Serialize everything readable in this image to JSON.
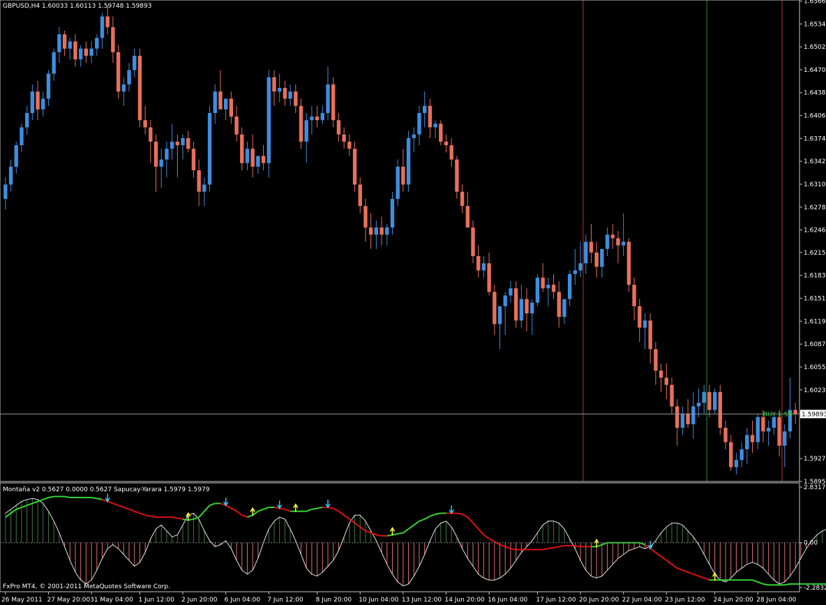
{
  "colors": {
    "background": "#000000",
    "bull": "#3d8ee0",
    "bear": "#e8705a",
    "grid_red": "#c0302c",
    "grid_green": "#2e8b2e",
    "axis": "#c8c8c8",
    "indicator_green": "#33d633",
    "indicator_red": "#e01010",
    "osc_line": "#e8e8e8",
    "hist_pos": "#3f7a3f",
    "hist_neg": "#e07070",
    "arrow_up": "#ffff33",
    "arrow_down": "#33ccff"
  },
  "header": {
    "symbol_line": "GBPUSD,H4  1.60033 1.60113 1.59748 1.59893",
    "indicator_line": "Montaña v2 0.5627 0.0000 0.5627 Sapucay-Yarara 1.5979 1.5979",
    "copyright": "FxPro MT4, © 2001-2011 MetaQuotes Software Corp."
  },
  "price_axis": {
    "ticks": [
      "1.65665",
      "1.65345",
      "1.65025",
      "1.64705",
      "1.64385",
      "1.64065",
      "1.63745",
      "1.63425",
      "1.63105",
      "1.62785",
      "1.62465",
      "1.62150",
      "1.61830",
      "1.61510",
      "1.61190",
      "1.60870",
      "1.60550",
      "1.60230",
      "1.59910",
      "1.59270",
      "1.58950"
    ],
    "current_price": "1.59893",
    "bid_label": "BUY 1.59"
  },
  "indicator_axis": {
    "ticks": [
      "2.8317",
      "0.00",
      "-2.2832"
    ]
  },
  "time_axis": {
    "labels": [
      "26 May 2011",
      "27 May 20:00",
      "31 May 04:00",
      "1 Jun 12:00",
      "2 Jun 20:00",
      "6 Jun 04:00",
      "7 Jun 12:00",
      "8 Jun 20:00",
      "10 Jun 04:00",
      "13 Jun 12:00",
      "14 Jun 20:00",
      "16 Jun 04:00",
      "17 Jun 12:00",
      "20 Jun 20:00",
      "22 Jun 04:00",
      "23 Jun 12:00",
      "24 Jun 20:00",
      "28 Jun 04:00"
    ]
  },
  "chart_data": {
    "type": "candlestick",
    "symbol": "GBPUSD",
    "timeframe": "H4",
    "ylim": [
      1.5895,
      1.6566
    ],
    "ohlc": [
      [
        1.629,
        1.632,
        1.6275,
        1.631
      ],
      [
        1.631,
        1.6345,
        1.63,
        1.6335
      ],
      [
        1.6335,
        1.637,
        1.6325,
        1.6365
      ],
      [
        1.6365,
        1.6395,
        1.6355,
        1.639
      ],
      [
        1.639,
        1.642,
        1.638,
        1.641
      ],
      [
        1.641,
        1.645,
        1.64,
        1.644
      ],
      [
        1.644,
        1.6455,
        1.64,
        1.6415
      ],
      [
        1.6415,
        1.644,
        1.6405,
        1.643
      ],
      [
        1.643,
        1.647,
        1.642,
        1.6465
      ],
      [
        1.6465,
        1.65,
        1.6455,
        1.6495
      ],
      [
        1.6495,
        1.653,
        1.648,
        1.652
      ],
      [
        1.652,
        1.6525,
        1.649,
        1.65
      ],
      [
        1.65,
        1.6515,
        1.6485,
        1.651
      ],
      [
        1.651,
        1.652,
        1.6475,
        1.6485
      ],
      [
        1.6485,
        1.6505,
        1.6475,
        1.65
      ],
      [
        1.65,
        1.651,
        1.648,
        1.649
      ],
      [
        1.649,
        1.651,
        1.648,
        1.65
      ],
      [
        1.65,
        1.652,
        1.649,
        1.6515
      ],
      [
        1.6515,
        1.655,
        1.65,
        1.6545
      ],
      [
        1.6545,
        1.656,
        1.652,
        1.653
      ],
      [
        1.653,
        1.6545,
        1.648,
        1.6495
      ],
      [
        1.6495,
        1.6505,
        1.643,
        1.644
      ],
      [
        1.644,
        1.646,
        1.642,
        1.645
      ],
      [
        1.645,
        1.648,
        1.644,
        1.647
      ],
      [
        1.647,
        1.65,
        1.646,
        1.649
      ],
      [
        1.649,
        1.65,
        1.639,
        1.64
      ],
      [
        1.64,
        1.642,
        1.638,
        1.639
      ],
      [
        1.639,
        1.64,
        1.634,
        1.637
      ],
      [
        1.637,
        1.638,
        1.63,
        1.6335
      ],
      [
        1.6335,
        1.636,
        1.6305,
        1.6345
      ],
      [
        1.6345,
        1.637,
        1.632,
        1.636
      ],
      [
        1.636,
        1.6395,
        1.6345,
        1.637
      ],
      [
        1.637,
        1.638,
        1.632,
        1.6365
      ],
      [
        1.6365,
        1.638,
        1.6345,
        1.6375
      ],
      [
        1.6375,
        1.6385,
        1.6355,
        1.636
      ],
      [
        1.636,
        1.637,
        1.632,
        1.633
      ],
      [
        1.633,
        1.6345,
        1.628,
        1.63
      ],
      [
        1.63,
        1.632,
        1.628,
        1.631
      ],
      [
        1.631,
        1.642,
        1.63,
        1.641
      ],
      [
        1.641,
        1.645,
        1.6395,
        1.644
      ],
      [
        1.644,
        1.647,
        1.642,
        1.6415
      ],
      [
        1.6415,
        1.643,
        1.64,
        1.643
      ],
      [
        1.643,
        1.644,
        1.6395,
        1.6405
      ],
      [
        1.6405,
        1.642,
        1.637,
        1.638
      ],
      [
        1.638,
        1.639,
        1.633,
        1.634
      ],
      [
        1.634,
        1.637,
        1.633,
        1.636
      ],
      [
        1.636,
        1.638,
        1.632,
        1.6335
      ],
      [
        1.6335,
        1.635,
        1.6325,
        1.635
      ],
      [
        1.635,
        1.6365,
        1.633,
        1.634
      ],
      [
        1.634,
        1.647,
        1.632,
        1.646
      ],
      [
        1.646,
        1.647,
        1.642,
        1.644
      ],
      [
        1.644,
        1.6465,
        1.6425,
        1.6445
      ],
      [
        1.6445,
        1.6455,
        1.642,
        1.643
      ],
      [
        1.643,
        1.645,
        1.642,
        1.644
      ],
      [
        1.644,
        1.645,
        1.641,
        1.642
      ],
      [
        1.642,
        1.643,
        1.636,
        1.637
      ],
      [
        1.637,
        1.641,
        1.634,
        1.64
      ],
      [
        1.64,
        1.642,
        1.638,
        1.6405
      ],
      [
        1.6405,
        1.642,
        1.639,
        1.64
      ],
      [
        1.64,
        1.642,
        1.6395,
        1.641
      ],
      [
        1.641,
        1.6475,
        1.64,
        1.645
      ],
      [
        1.645,
        1.646,
        1.639,
        1.64
      ],
      [
        1.64,
        1.641,
        1.637,
        1.638
      ],
      [
        1.638,
        1.639,
        1.636,
        1.637
      ],
      [
        1.637,
        1.638,
        1.635,
        1.636
      ],
      [
        1.636,
        1.637,
        1.63,
        1.631
      ],
      [
        1.631,
        1.632,
        1.627,
        1.628
      ],
      [
        1.628,
        1.629,
        1.623,
        1.625
      ],
      [
        1.625,
        1.627,
        1.622,
        1.624
      ],
      [
        1.624,
        1.626,
        1.622,
        1.625
      ],
      [
        1.625,
        1.6265,
        1.6225,
        1.624
      ],
      [
        1.624,
        1.6255,
        1.6225,
        1.625
      ],
      [
        1.625,
        1.63,
        1.624,
        1.629
      ],
      [
        1.629,
        1.6345,
        1.628,
        1.6335
      ],
      [
        1.6335,
        1.636,
        1.63,
        1.631
      ],
      [
        1.631,
        1.6385,
        1.63,
        1.6375
      ],
      [
        1.6375,
        1.639,
        1.6355,
        1.638
      ],
      [
        1.638,
        1.642,
        1.6365,
        1.641
      ],
      [
        1.641,
        1.644,
        1.639,
        1.642
      ],
      [
        1.642,
        1.643,
        1.6375,
        1.639
      ],
      [
        1.639,
        1.64,
        1.6375,
        1.6395
      ],
      [
        1.6395,
        1.64,
        1.6365,
        1.637
      ],
      [
        1.637,
        1.638,
        1.6355,
        1.6365
      ],
      [
        1.6365,
        1.6375,
        1.6335,
        1.6345
      ],
      [
        1.6345,
        1.635,
        1.629,
        1.63
      ],
      [
        1.63,
        1.631,
        1.627,
        1.628
      ],
      [
        1.628,
        1.63,
        1.625,
        1.625
      ],
      [
        1.625,
        1.626,
        1.62,
        1.621
      ],
      [
        1.621,
        1.6225,
        1.618,
        1.619
      ],
      [
        1.619,
        1.621,
        1.618,
        1.62
      ],
      [
        1.62,
        1.6215,
        1.6155,
        1.616
      ],
      [
        1.616,
        1.617,
        1.61,
        1.6115
      ],
      [
        1.6115,
        1.614,
        1.608,
        1.614
      ],
      [
        1.614,
        1.616,
        1.61,
        1.6155
      ],
      [
        1.6155,
        1.6175,
        1.6145,
        1.6165
      ],
      [
        1.6165,
        1.6175,
        1.611,
        1.612
      ],
      [
        1.612,
        1.617,
        1.611,
        1.615
      ],
      [
        1.615,
        1.6165,
        1.6105,
        1.613
      ],
      [
        1.613,
        1.615,
        1.61,
        1.6145
      ],
      [
        1.6145,
        1.6185,
        1.614,
        1.618
      ],
      [
        1.618,
        1.62,
        1.616,
        1.6165
      ],
      [
        1.6165,
        1.618,
        1.614,
        1.617
      ],
      [
        1.617,
        1.6185,
        1.615,
        1.616
      ],
      [
        1.616,
        1.6175,
        1.611,
        1.6125
      ],
      [
        1.6125,
        1.615,
        1.6115,
        1.615
      ],
      [
        1.615,
        1.619,
        1.614,
        1.6185
      ],
      [
        1.6185,
        1.622,
        1.617,
        1.619
      ],
      [
        1.619,
        1.623,
        1.618,
        1.62
      ],
      [
        1.62,
        1.624,
        1.6185,
        1.623
      ],
      [
        1.623,
        1.6255,
        1.62,
        1.6215
      ],
      [
        1.6215,
        1.623,
        1.618,
        1.6195
      ],
      [
        1.6195,
        1.622,
        1.618,
        1.622
      ],
      [
        1.622,
        1.625,
        1.621,
        1.624
      ],
      [
        1.624,
        1.6255,
        1.622,
        1.6235
      ],
      [
        1.6235,
        1.6245,
        1.62,
        1.6225
      ],
      [
        1.6225,
        1.627,
        1.621,
        1.623
      ],
      [
        1.623,
        1.6235,
        1.616,
        1.617
      ],
      [
        1.617,
        1.618,
        1.612,
        1.614
      ],
      [
        1.614,
        1.615,
        1.609,
        1.611
      ],
      [
        1.611,
        1.613,
        1.608,
        1.612
      ],
      [
        1.612,
        1.613,
        1.606,
        1.608
      ],
      [
        1.608,
        1.609,
        1.603,
        1.605
      ],
      [
        1.605,
        1.606,
        1.602,
        1.604
      ],
      [
        1.604,
        1.606,
        1.601,
        1.603
      ],
      [
        1.603,
        1.604,
        1.599,
        1.6
      ],
      [
        1.6,
        1.601,
        1.5945,
        1.597
      ],
      [
        1.597,
        1.6,
        1.596,
        1.599
      ],
      [
        1.599,
        1.601,
        1.597,
        1.5975
      ],
      [
        1.5975,
        1.602,
        1.5955,
        1.6
      ],
      [
        1.6,
        1.6025,
        1.5985,
        1.6005
      ],
      [
        1.6005,
        1.603,
        1.599,
        1.602
      ],
      [
        1.602,
        1.603,
        1.5985,
        1.5995
      ],
      [
        1.5995,
        1.6025,
        1.599,
        1.602
      ],
      [
        1.602,
        1.603,
        1.596,
        1.597
      ],
      [
        1.597,
        1.598,
        1.594,
        1.595
      ],
      [
        1.595,
        1.596,
        1.591,
        1.5915
      ],
      [
        1.5915,
        1.5935,
        1.5905,
        1.5925
      ],
      [
        1.5925,
        1.595,
        1.5915,
        1.594
      ],
      [
        1.594,
        1.597,
        1.592,
        1.596
      ],
      [
        1.596,
        1.598,
        1.5935,
        1.595
      ],
      [
        1.595,
        1.599,
        1.594,
        1.5985
      ],
      [
        1.5985,
        1.5995,
        1.595,
        1.5965
      ],
      [
        1.5965,
        1.598,
        1.5945,
        1.597
      ],
      [
        1.597,
        1.599,
        1.596,
        1.5985
      ],
      [
        1.5985,
        1.5995,
        1.593,
        1.5945
      ],
      [
        1.5945,
        1.5975,
        1.5915,
        1.5965
      ],
      [
        1.5965,
        1.604,
        1.5955,
        1.5995
      ],
      [
        1.5995,
        1.6005,
        1.5975,
        1.5989
      ]
    ],
    "vlines": [
      {
        "bar": 107.5,
        "color": "red"
      },
      {
        "bar": 130.5,
        "color": "green"
      },
      {
        "bar": 144.5,
        "color": "red"
      },
      {
        "bar": 177.5,
        "color": "green"
      }
    ],
    "indicator": {
      "name": "Montaña v2 / Sapucay-Yarara",
      "ylim": [
        -2.2832,
        2.8317
      ],
      "oscillator": [
        1.5,
        1.7,
        1.9,
        2.1,
        2.2,
        2.25,
        2.2,
        2.0,
        1.6,
        1.1,
        0.5,
        -0.2,
        -0.9,
        -1.5,
        -1.9,
        -2.1,
        -1.9,
        -1.4,
        -0.8,
        -0.3,
        -0.1,
        -0.3,
        -0.6,
        -0.9,
        -1.2,
        -1.0,
        -0.5,
        0.2,
        0.7,
        0.9,
        0.6,
        0.3,
        0.4,
        0.9,
        1.4,
        1.5,
        1.2,
        0.6,
        0.1,
        -0.2,
        -0.1,
        0.1,
        -0.3,
        -0.9,
        -1.4,
        -1.6,
        -1.4,
        -0.8,
        0.0,
        0.7,
        1.1,
        1.3,
        1.2,
        0.7,
        0.1,
        -0.6,
        -1.3,
        -1.6,
        -1.7,
        -1.5,
        -1.2,
        -0.9,
        -0.4,
        0.3,
        1.0,
        1.4,
        1.4,
        1.1,
        0.6,
        0.1,
        -0.5,
        -1.1,
        -1.6,
        -2.0,
        -2.2,
        -2.1,
        -1.7,
        -1.2,
        -0.6,
        0.1,
        0.7,
        1.0,
        1.1,
        0.8,
        0.3,
        -0.3,
        -0.8,
        -1.2,
        -1.6,
        -1.8,
        -1.9,
        -1.9,
        -1.8,
        -1.6,
        -1.3,
        -0.9,
        -0.5,
        -0.2,
        0.1,
        0.5,
        0.9,
        1.1,
        1.1,
        1.0,
        0.7,
        0.2,
        -0.3,
        -0.9,
        -1.4,
        -1.7,
        -1.8,
        -1.7,
        -1.4,
        -1.1,
        -0.8,
        -0.6,
        -0.4,
        -0.3,
        -0.2,
        -0.3,
        -0.2,
        0.1,
        0.5,
        0.8,
        1.0,
        1.0,
        0.9,
        0.6,
        0.3,
        -0.1,
        -0.6,
        -1.1,
        -1.6,
        -1.9,
        -2.0,
        -1.8,
        -1.5,
        -1.3,
        -1.1,
        -1.0,
        -1.1,
        -1.3,
        -1.6,
        -1.9,
        -2.1,
        -2.0,
        -1.7,
        -1.3,
        -0.8,
        -0.3,
        0.1,
        0.4,
        0.6,
        0.7,
        0.7
      ],
      "signal": [
        1.3,
        1.5,
        1.7,
        1.8,
        1.9,
        2.0,
        2.1,
        2.2,
        2.3,
        2.35,
        2.35,
        2.35,
        2.3,
        2.3,
        2.3,
        2.3,
        2.3,
        2.25,
        2.2,
        2.1,
        2.0,
        1.9,
        1.8,
        1.7,
        1.6,
        1.5,
        1.4,
        1.35,
        1.3,
        1.3,
        1.3,
        1.3,
        1.25,
        1.2,
        1.15,
        1.2,
        1.3,
        1.6,
        1.9,
        2.0,
        2.0,
        1.9,
        1.75,
        1.6,
        1.4,
        1.3,
        1.4,
        1.6,
        1.7,
        1.8,
        1.8,
        1.75,
        1.7,
        1.6,
        1.6,
        1.6,
        1.6,
        1.7,
        1.75,
        1.8,
        1.8,
        1.75,
        1.6,
        1.4,
        1.2,
        1.0,
        0.8,
        0.6,
        0.5,
        0.4,
        0.35,
        0.35,
        0.4,
        0.45,
        0.5,
        0.7,
        0.9,
        1.1,
        1.2,
        1.35,
        1.45,
        1.5,
        1.5,
        1.5,
        1.5,
        1.45,
        1.3,
        1.0,
        0.7,
        0.4,
        0.2,
        0.05,
        -0.1,
        -0.2,
        -0.3,
        -0.35,
        -0.35,
        -0.35,
        -0.35,
        -0.35,
        -0.35,
        -0.3,
        -0.25,
        -0.2,
        -0.15,
        -0.15,
        -0.15,
        -0.2,
        -0.2,
        -0.2,
        -0.2,
        -0.1,
        0.0,
        0.0,
        0.0,
        0.0,
        0.0,
        0.0,
        0.0,
        -0.1,
        -0.3,
        -0.5,
        -0.7,
        -0.9,
        -1.1,
        -1.3,
        -1.4,
        -1.5,
        -1.6,
        -1.7,
        -1.8,
        -1.9,
        -1.9,
        -1.9,
        -1.9,
        -1.9,
        -1.9,
        -1.9,
        -1.9,
        -1.9,
        -2.0,
        -2.1,
        -2.15,
        -2.15,
        -2.15,
        -2.15,
        -2.1,
        -2.1,
        -2.1,
        -2.1,
        -2.1,
        -2.1,
        -2.1,
        -2.1
      ],
      "signal_bullish": [
        1,
        1,
        1,
        1,
        1,
        1,
        1,
        1,
        1,
        1,
        1,
        1,
        1,
        1,
        1,
        1,
        1,
        1,
        1,
        0,
        0,
        0,
        0,
        0,
        0,
        0,
        0,
        0,
        0,
        0,
        0,
        0,
        0,
        0,
        1,
        1,
        1,
        1,
        1,
        1,
        1,
        0,
        0,
        0,
        0,
        0,
        1,
        1,
        1,
        1,
        1,
        0,
        0,
        0,
        1,
        1,
        1,
        1,
        1,
        1,
        0,
        0,
        0,
        0,
        0,
        0,
        0,
        0,
        0,
        0,
        0,
        0,
        1,
        1,
        1,
        1,
        1,
        1,
        1,
        1,
        1,
        1,
        1,
        0,
        0,
        0,
        0,
        0,
        0,
        0,
        0,
        0,
        0,
        0,
        0,
        0,
        0,
        0,
        0,
        0,
        0,
        0,
        0,
        0,
        0,
        0,
        0,
        0,
        0,
        0,
        1,
        1,
        1,
        1,
        1,
        1,
        1,
        1,
        1,
        1,
        0,
        0,
        0,
        0,
        0,
        0,
        0,
        0,
        0,
        0,
        0,
        0,
        1,
        1,
        1,
        1,
        1,
        1,
        1,
        1,
        1,
        1,
        1,
        1,
        1,
        1,
        1,
        1,
        1,
        1,
        1,
        1,
        1,
        1,
        1,
        1,
        1,
        1,
        1,
        1
      ]
    }
  }
}
